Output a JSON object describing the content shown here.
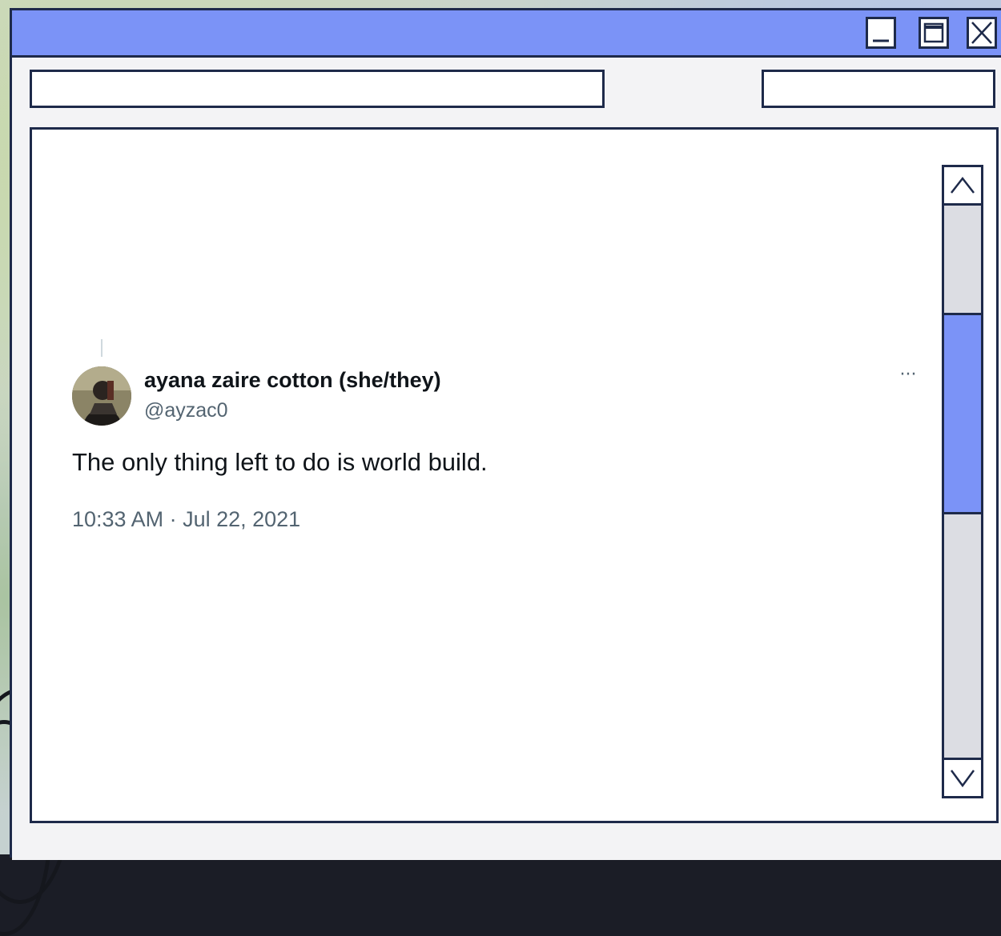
{
  "window": {
    "title": "",
    "titlebar_color": "#7b93f7",
    "border_color": "#1e2a4a",
    "buttons": {
      "minimize_icon": "minimize-icon",
      "maximize_icon": "maximize-icon",
      "close_icon": "close-icon"
    }
  },
  "toolbar": {
    "left_field_value": "",
    "right_field_value": ""
  },
  "tweet": {
    "display_name": "ayana zaire cotton (she/they)",
    "handle": "@ayzac0",
    "text": "The only thing left to do is world build.",
    "timestamp": "10:33 AM · Jul 22, 2021",
    "more_label": "···",
    "avatar_icon": "avatar"
  },
  "scrollbar": {
    "up_icon": "chevron-up-icon",
    "down_icon": "chevron-down-icon",
    "thumb_color": "#7b93f7",
    "track_color": "#dcdde3"
  }
}
